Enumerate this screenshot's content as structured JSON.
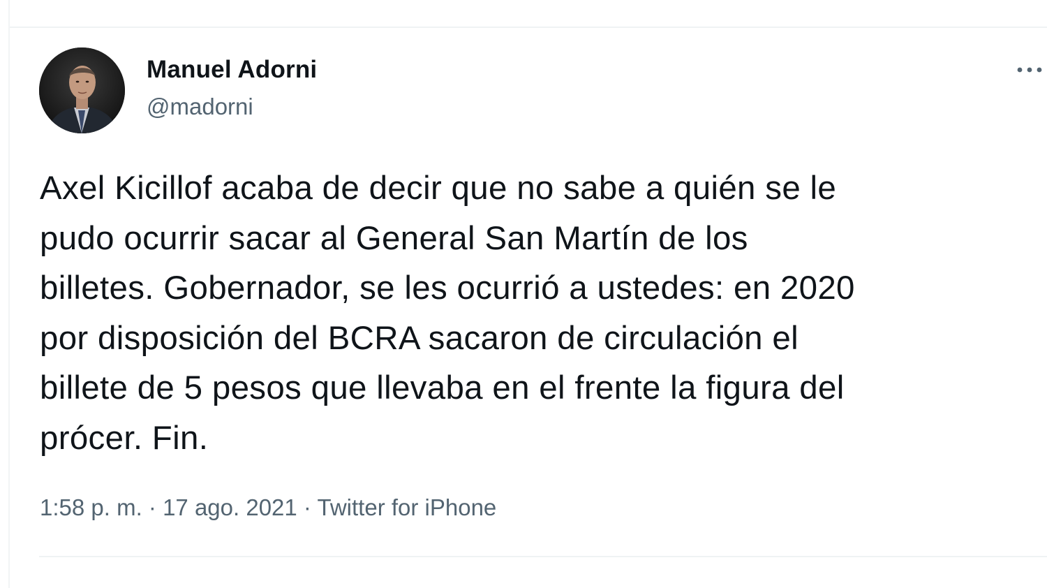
{
  "tweet": {
    "author": {
      "name": "Manuel Adorni",
      "handle": "@madorni"
    },
    "text": "Axel Kicillof acaba de decir que no sabe a quién se le\npudo ocurrir sacar al General San Martín de los\nbilletes. Gobernador, se les ocurrió a ustedes: en 2020\npor disposición del BCRA sacaron de circulación el\nbillete de 5 pesos que llevaba en el frente la figura del\nprócer. Fin.",
    "time": "1:58 p. m.",
    "separator": " · ",
    "date": "17 ago. 2021",
    "source": "Twitter for iPhone",
    "more_icon": "more-horizontal-icon"
  },
  "colors": {
    "text_primary": "#0f1419",
    "text_secondary": "#536471",
    "divider": "#eff3f4"
  }
}
